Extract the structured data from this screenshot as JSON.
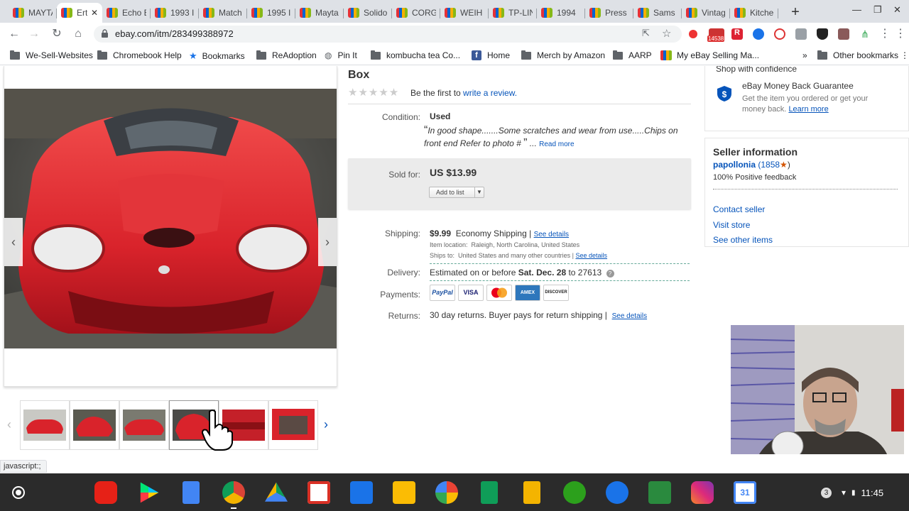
{
  "browser": {
    "tabs": [
      {
        "label": "MAYTA",
        "active": false
      },
      {
        "label": "Ert",
        "active": true
      },
      {
        "label": "Echo E",
        "active": false
      },
      {
        "label": "1993 I",
        "active": false
      },
      {
        "label": "Match",
        "active": false
      },
      {
        "label": "1995 I",
        "active": false
      },
      {
        "label": "Mayta",
        "active": false
      },
      {
        "label": "Solido",
        "active": false
      },
      {
        "label": "CORG",
        "active": false
      },
      {
        "label": "WEIH",
        "active": false
      },
      {
        "label": "TP-LIN",
        "active": false
      },
      {
        "label": "1994",
        "active": false
      },
      {
        "label": "Press",
        "active": false
      },
      {
        "label": "Sams",
        "active": false
      },
      {
        "label": "Vintag",
        "active": false
      },
      {
        "label": "Kitche",
        "active": false
      }
    ],
    "url": "ebay.com/itm/283499388972",
    "extension_badge": "14538",
    "bookmarks": [
      {
        "label": "We-Sell-Websites",
        "icon": "folder-icon"
      },
      {
        "label": "Chromebook Help",
        "icon": "folder-icon"
      },
      {
        "label": "Bookmarks",
        "icon": "star-icon"
      },
      {
        "label": "ReAdoption",
        "icon": "folder-icon"
      },
      {
        "label": "Pin It",
        "icon": "globe-icon"
      },
      {
        "label": "kombucha tea Co...",
        "icon": "folder-icon"
      },
      {
        "label": "Home",
        "icon": "facebook-icon"
      },
      {
        "label": "Merch by Amazon",
        "icon": "folder-icon"
      },
      {
        "label": "AARP",
        "icon": "folder-icon"
      },
      {
        "label": "My eBay Selling Ma...",
        "icon": "ebay-icon"
      },
      {
        "label": "Other bookmarks",
        "icon": "folder-icon"
      }
    ],
    "bookmarks_overflow": "»"
  },
  "listing": {
    "title_fragment": "Box",
    "review_prompt": "Be the first to",
    "review_link": "write a review.",
    "condition_label": "Condition:",
    "condition_value": "Used",
    "condition_note": "In good shape.......Some scratches and wear from use.....Chips on front end Refer to photo #",
    "read_more": "Read more",
    "sold_label": "Sold for:",
    "sold_price": "US $13.99",
    "add_to_list": "Add to list",
    "shipping_label": "Shipping:",
    "shipping_price": "$9.99",
    "shipping_method": "Economy Shipping |",
    "see_details": "See details",
    "item_location_label": "Item location:",
    "item_location": "Raleigh, North Carolina, United States",
    "ships_to_label": "Ships to:",
    "ships_to": "United States and many other countries |",
    "delivery_label": "Delivery:",
    "delivery_text": "Estimated on or before",
    "delivery_date": "Sat. Dec. 28",
    "delivery_to": "to 27613",
    "payments_label": "Payments:",
    "payment_methods": [
      "PayPal",
      "VISA",
      "MasterCard",
      "AMEX",
      "DISCOVER"
    ],
    "returns_label": "Returns:",
    "returns_text": "30 day returns. Buyer pays for return shipping |",
    "returns_details": "See details"
  },
  "sidebar": {
    "shop_with_confidence": "Shop with confidence",
    "guarantee_title": "eBay Money Back Guarantee",
    "guarantee_text": "Get the item you ordered or get your money back.",
    "learn_more": "Learn more",
    "seller_heading": "Seller information",
    "seller_name": "papollonia",
    "seller_score": "(1858",
    "seller_score_close": ")",
    "feedback": "100% Positive feedback",
    "contact_seller": "Contact seller",
    "visit_store": "Visit store",
    "other_items": "See other items"
  },
  "status_text": "javascript:;",
  "shelf": {
    "apps": [
      "YouTube",
      "Play Store",
      "Docs",
      "Chrome",
      "Drive",
      "Gmail",
      "Files",
      "Keep",
      "Photos",
      "Sheets",
      "Slides",
      "QuickBooks",
      "Messages",
      "Snapseed",
      "Instagram",
      "Calendar"
    ],
    "notification_count": "3",
    "time": "11:45",
    "calendar_day": "31"
  },
  "colors": {
    "ebay_link": "#0654ba",
    "car_red": "#d9232b",
    "shelf_bg": "#2b2b2b"
  }
}
